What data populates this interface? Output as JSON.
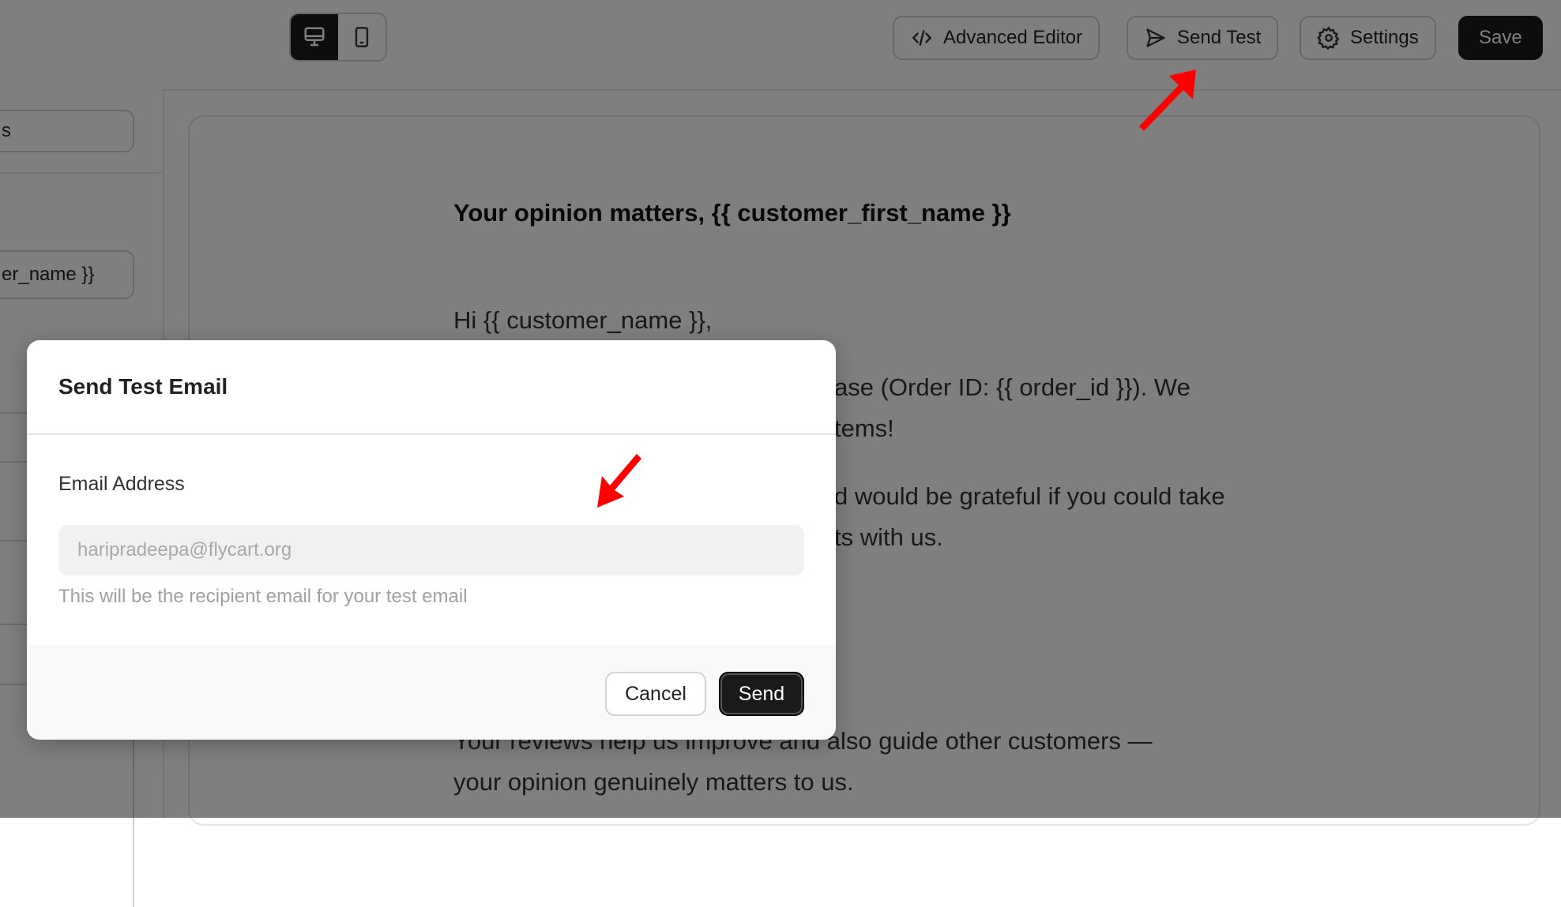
{
  "toolbar": {
    "advanced_editor_label": "Advanced Editor",
    "send_test_label": "Send Test",
    "settings_label": "Settings",
    "save_label": "Save"
  },
  "sidebar": {
    "field1_text": "s",
    "field2_text": "er_name }}"
  },
  "email": {
    "title": "Your opinion matters, {{ customer_first_name }}",
    "greeting": "Hi {{ customer_name }},",
    "p1_line1": "ase (Order ID: {{ order_id }}). We",
    "p1_line2": "tems!",
    "p2_line1": "d would be grateful if you could take",
    "p2_line2": "ts with us.",
    "p3_line1": "Your reviews help us improve and also guide other customers —",
    "p3_line2": "your opinion genuinely matters to us."
  },
  "modal": {
    "title": "Send Test Email",
    "email_label": "Email Address",
    "email_placeholder": "haripradeepa@flycart.org",
    "email_value": "",
    "help_text": "This will be the recipient email for your test email",
    "cancel_label": "Cancel",
    "send_label": "Send"
  },
  "colors": {
    "overlay": "rgba(0,0,0,0.5)",
    "primary_button": "#1a1a1a",
    "annotation_arrow": "#ff0000"
  }
}
